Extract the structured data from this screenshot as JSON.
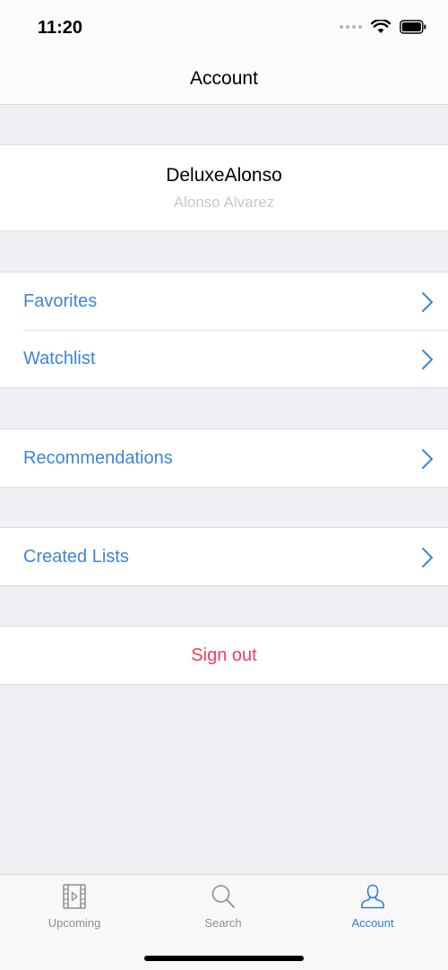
{
  "status_bar": {
    "time": "11:20"
  },
  "nav": {
    "title": "Account"
  },
  "profile": {
    "username": "DeluxeAlonso",
    "full_name": "Alonso Alvarez"
  },
  "menu": {
    "favorites": "Favorites",
    "watchlist": "Watchlist",
    "recommendations": "Recommendations",
    "created_lists": "Created Lists",
    "sign_out": "Sign out"
  },
  "tabs": [
    {
      "label": "Upcoming",
      "icon": "film-icon",
      "active": false
    },
    {
      "label": "Search",
      "icon": "search-icon",
      "active": false
    },
    {
      "label": "Account",
      "icon": "person-icon",
      "active": true
    }
  ],
  "colors": {
    "accent": "#3c86d6",
    "tab_active": "#2f7fd6",
    "destructive": "#f23c5a",
    "background": "#f0f0f4",
    "secondary_text": "#c8c8cc"
  }
}
